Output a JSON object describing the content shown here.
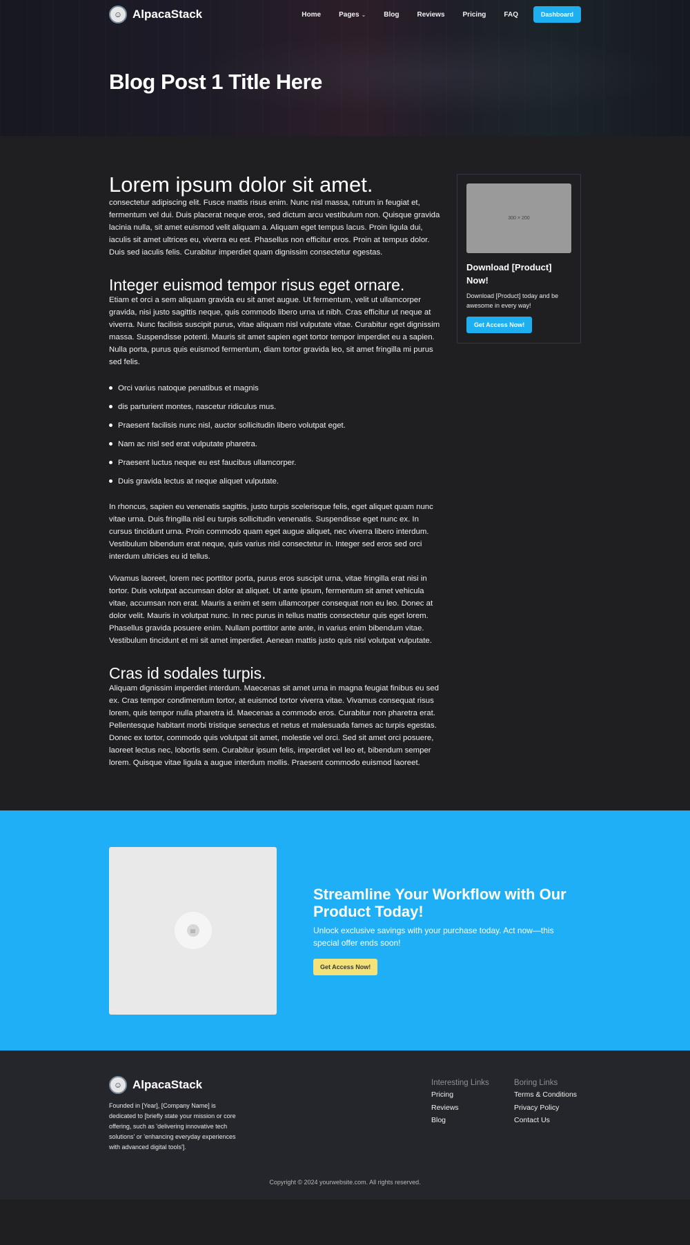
{
  "nav": {
    "brand": "AlpacaStack",
    "links": [
      {
        "label": "Home"
      },
      {
        "label": "Pages"
      },
      {
        "label": "Blog"
      },
      {
        "label": "Reviews"
      },
      {
        "label": "Pricing"
      },
      {
        "label": "FAQ"
      }
    ],
    "dashboard_label": "Dashboard"
  },
  "hero": {
    "title": "Blog Post 1 Title Here"
  },
  "article": {
    "h1": "Lorem ipsum dolor sit amet.",
    "p1": "consectetur adipiscing elit. Fusce mattis risus enim. Nunc nisl massa, rutrum in feugiat et, fermentum vel dui. Duis placerat neque eros, sed dictum arcu vestibulum non. Quisque gravida lacinia nulla, sit amet euismod velit aliquam a. Aliquam eget tempus lacus. Proin ligula dui, iaculis sit amet ultrices eu, viverra eu est. Phasellus non efficitur eros. Proin at tempus dolor. Duis sed iaculis felis. Curabitur imperdiet quam dignissim consectetur egestas.",
    "h2": "Integer euismod tempor risus eget ornare.",
    "p2": "Etiam et orci a sem aliquam gravida eu sit amet augue. Ut fermentum, velit ut ullamcorper gravida, nisi justo sagittis neque, quis commodo libero urna ut nibh. Cras efficitur ut neque at viverra. Nunc facilisis suscipit purus, vitae aliquam nisl vulputate vitae. Curabitur eget dignissim massa. Suspendisse potenti. Mauris sit amet sapien eget tortor tempor imperdiet eu a sapien. Nulla porta, purus quis euismod fermentum, diam tortor gravida leo, sit amet fringilla mi purus sed felis.",
    "list": [
      "Orci varius natoque penatibus et magnis",
      "dis parturient montes, nascetur ridiculus mus.",
      "Praesent facilisis nunc nisl, auctor sollicitudin libero volutpat eget.",
      "Nam ac nisl sed erat vulputate pharetra.",
      "Praesent luctus neque eu est faucibus ullamcorper.",
      "Duis gravida lectus at neque aliquet vulputate."
    ],
    "p3": "In rhoncus, sapien eu venenatis sagittis, justo turpis scelerisque felis, eget aliquet quam nunc vitae urna. Duis fringilla nisl eu turpis sollicitudin venenatis. Suspendisse eget nunc ex. In cursus tincidunt urna. Proin commodo quam eget augue aliquet, nec viverra libero interdum. Vestibulum bibendum erat neque, quis varius nisl consectetur in. Integer sed eros sed orci interdum ultricies eu id tellus.",
    "p4": "Vivamus laoreet, lorem nec porttitor porta, purus eros suscipit urna, vitae fringilla erat nisi in tortor. Duis volutpat accumsan dolor at aliquet. Ut ante ipsum, fermentum sit amet vehicula vitae, accumsan non erat. Mauris a enim et sem ullamcorper consequat non eu leo. Donec at dolor velit. Mauris in volutpat nunc. In nec purus in tellus mattis consectetur quis eget lorem. Phasellus gravida posuere enim. Nullam porttitor ante ante, in varius enim bibendum vitae. Vestibulum tincidunt et mi sit amet imperdiet. Aenean mattis justo quis nisl volutpat vulputate.",
    "h3": "Cras id sodales turpis.",
    "p5": "Aliquam dignissim imperdiet interdum. Maecenas sit amet urna in magna feugiat finibus eu sed ex. Cras tempor condimentum tortor, at euismod tortor viverra vitae. Vivamus consequat risus lorem, quis tempor nulla pharetra id. Maecenas a commodo eros. Curabitur non pharetra erat. Pellentesque habitant morbi tristique senectus et netus et malesuada fames ac turpis egestas. Donec ex tortor, commodo quis volutpat sit amet, molestie vel orci. Sed sit amet orci posuere, laoreet lectus nec, lobortis sem. Curabitur ipsum felis, imperdiet vel leo et, bibendum semper lorem. Quisque vitae ligula a augue interdum mollis. Praesent commodo euismod laoreet."
  },
  "sidebar": {
    "image_label": "300 × 200",
    "title": "Download [Product] Now!",
    "description": "Download [Product] today and be awesome in every way!",
    "button_label": "Get Access Now!"
  },
  "cta": {
    "title": "Streamline Your Workflow with Our Product Today!",
    "text": "Unlock exclusive savings with your purchase today. Act now—this special offer ends soon!",
    "button_label": "Get Access Now!"
  },
  "footer": {
    "brand": "AlpacaStack",
    "description": "Founded in [Year], [Company Name] is dedicated to [briefly state your mission or core offering, such as 'delivering innovative tech solutions' or 'enhancing everyday experiences with advanced digital tools'].",
    "col1": {
      "heading": "Interesting Links",
      "links": [
        "Pricing",
        "Reviews",
        "Blog"
      ]
    },
    "col2": {
      "heading": "Boring Links",
      "links": [
        "Terms & Conditions",
        "Privacy Policy",
        "Contact Us"
      ]
    },
    "copyright": "Copyright © 2024 yourwebsite.com. All rights reserved."
  },
  "colors": {
    "background": "#1f1f21",
    "accent": "#1eaff1",
    "cta_background": "#1eaff6",
    "cta_button": "#f3e27a",
    "footer_background": "#25262b"
  },
  "icons": {
    "logo": "alpaca-logo-icon",
    "dropdown": "chevron-down-icon",
    "image_placeholder": "image-icon"
  }
}
